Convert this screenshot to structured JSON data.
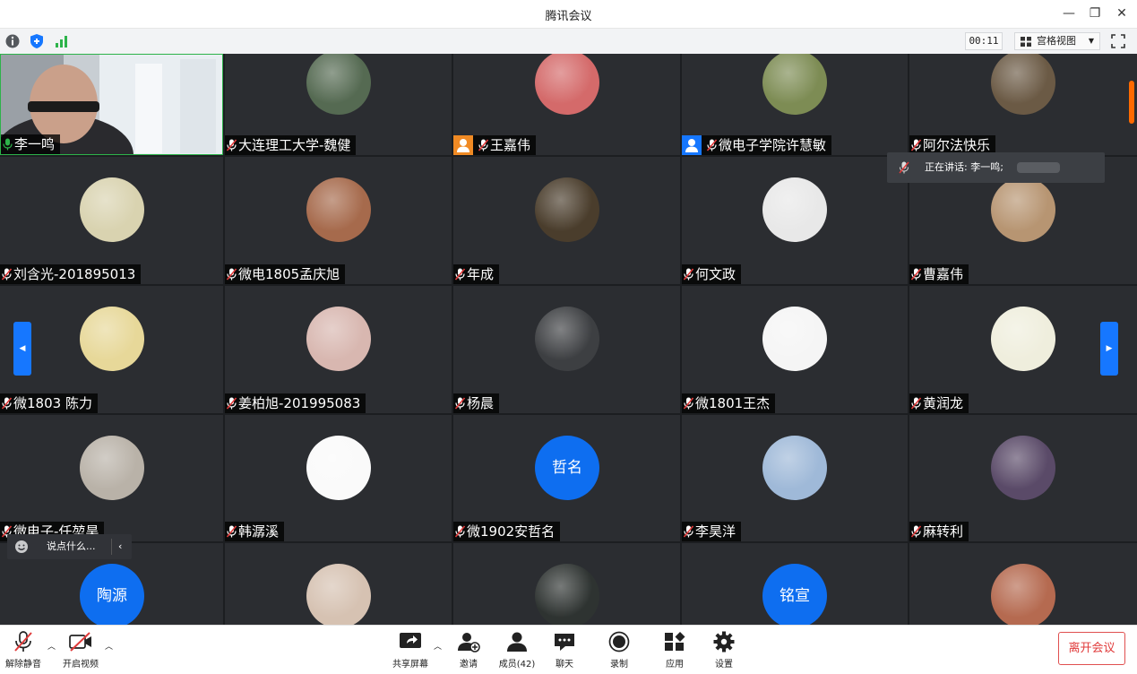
{
  "window": {
    "title": "腾讯会议",
    "minimize": "—",
    "maximize": "❐",
    "close": "✕"
  },
  "toolbar": {
    "timer": "00:11",
    "view_label": "宫格视图",
    "view_caret": "▼"
  },
  "speaking": {
    "label": "正在讲话: 李一鸣;"
  },
  "chat": {
    "placeholder": "说点什么...",
    "collapse": "‹"
  },
  "nav": {
    "prev": "◀",
    "next": "▶"
  },
  "participants": [
    {
      "name": "李一鸣",
      "mic": "on",
      "kind": "video"
    },
    {
      "name": "大连理工大学-魏健",
      "mic": "muted",
      "kind": "photo",
      "color": "#556a52"
    },
    {
      "name": "王嘉伟",
      "mic": "muted",
      "kind": "photo",
      "color": "#d46a6a",
      "role": "orange"
    },
    {
      "name": "微电子学院许慧敏",
      "mic": "muted",
      "kind": "photo",
      "color": "#7d8c54",
      "role": "blue"
    },
    {
      "name": "阿尔法快乐",
      "mic": "muted",
      "kind": "photo",
      "color": "#6b5a45"
    },
    {
      "name": "刘含光-201895013",
      "mic": "muted",
      "kind": "photo",
      "color": "#d9d3b0"
    },
    {
      "name": "微电1805孟庆旭",
      "mic": "muted",
      "kind": "photo",
      "color": "#a66a4c"
    },
    {
      "name": "年成",
      "mic": "muted",
      "kind": "photo",
      "color": "#4a3d2c"
    },
    {
      "name": "何文政",
      "mic": "muted",
      "kind": "photo",
      "color": "#e8e8e8"
    },
    {
      "name": "曹嘉伟",
      "mic": "muted",
      "kind": "photo",
      "color": "#b79572"
    },
    {
      "name": "微1803 陈力",
      "mic": "muted",
      "kind": "photo",
      "color": "#e7d899"
    },
    {
      "name": "姜柏旭-201995083",
      "mic": "muted",
      "kind": "photo",
      "color": "#d8b7b0"
    },
    {
      "name": "杨晨",
      "mic": "muted",
      "kind": "photo",
      "color": "#3d3f42"
    },
    {
      "name": "微1801王杰",
      "mic": "muted",
      "kind": "photo",
      "color": "#f5f5f5"
    },
    {
      "name": "黄润龙",
      "mic": "muted",
      "kind": "photo",
      "color": "#efeedd"
    },
    {
      "name": "微电子-任堃昊",
      "mic": "muted",
      "kind": "photo",
      "color": "#b9b2a8"
    },
    {
      "name": "韩潺溪",
      "mic": "muted",
      "kind": "photo",
      "color": "#fafafa"
    },
    {
      "name": "微1902安哲名",
      "mic": "muted",
      "kind": "text",
      "avatar_text": "哲名"
    },
    {
      "name": "李昊洋",
      "mic": "muted",
      "kind": "photo",
      "color": "#9fb9d8"
    },
    {
      "name": "麻转利",
      "mic": "muted",
      "kind": "photo",
      "color": "#5a4a68"
    },
    {
      "name": "",
      "mic": "",
      "kind": "text",
      "avatar_text": "陶源"
    },
    {
      "name": "",
      "mic": "",
      "kind": "photo",
      "color": "#d6c2b2"
    },
    {
      "name": "",
      "mic": "",
      "kind": "photo",
      "color": "#2e3331"
    },
    {
      "name": "",
      "mic": "",
      "kind": "text",
      "avatar_text": "铭宣"
    },
    {
      "name": "",
      "mic": "",
      "kind": "photo",
      "color": "#b56a50"
    }
  ],
  "bottom": {
    "unmute": "解除静音",
    "video": "开启视频",
    "share": "共享屏幕",
    "invite": "邀请",
    "members": "成员(42)",
    "chat": "聊天",
    "record": "录制",
    "apps": "应用",
    "settings": "设置",
    "leave": "离开会议"
  },
  "colors": {
    "accent": "#1677ff",
    "leave": "#e03a3a",
    "tile": "#2b2d31"
  }
}
